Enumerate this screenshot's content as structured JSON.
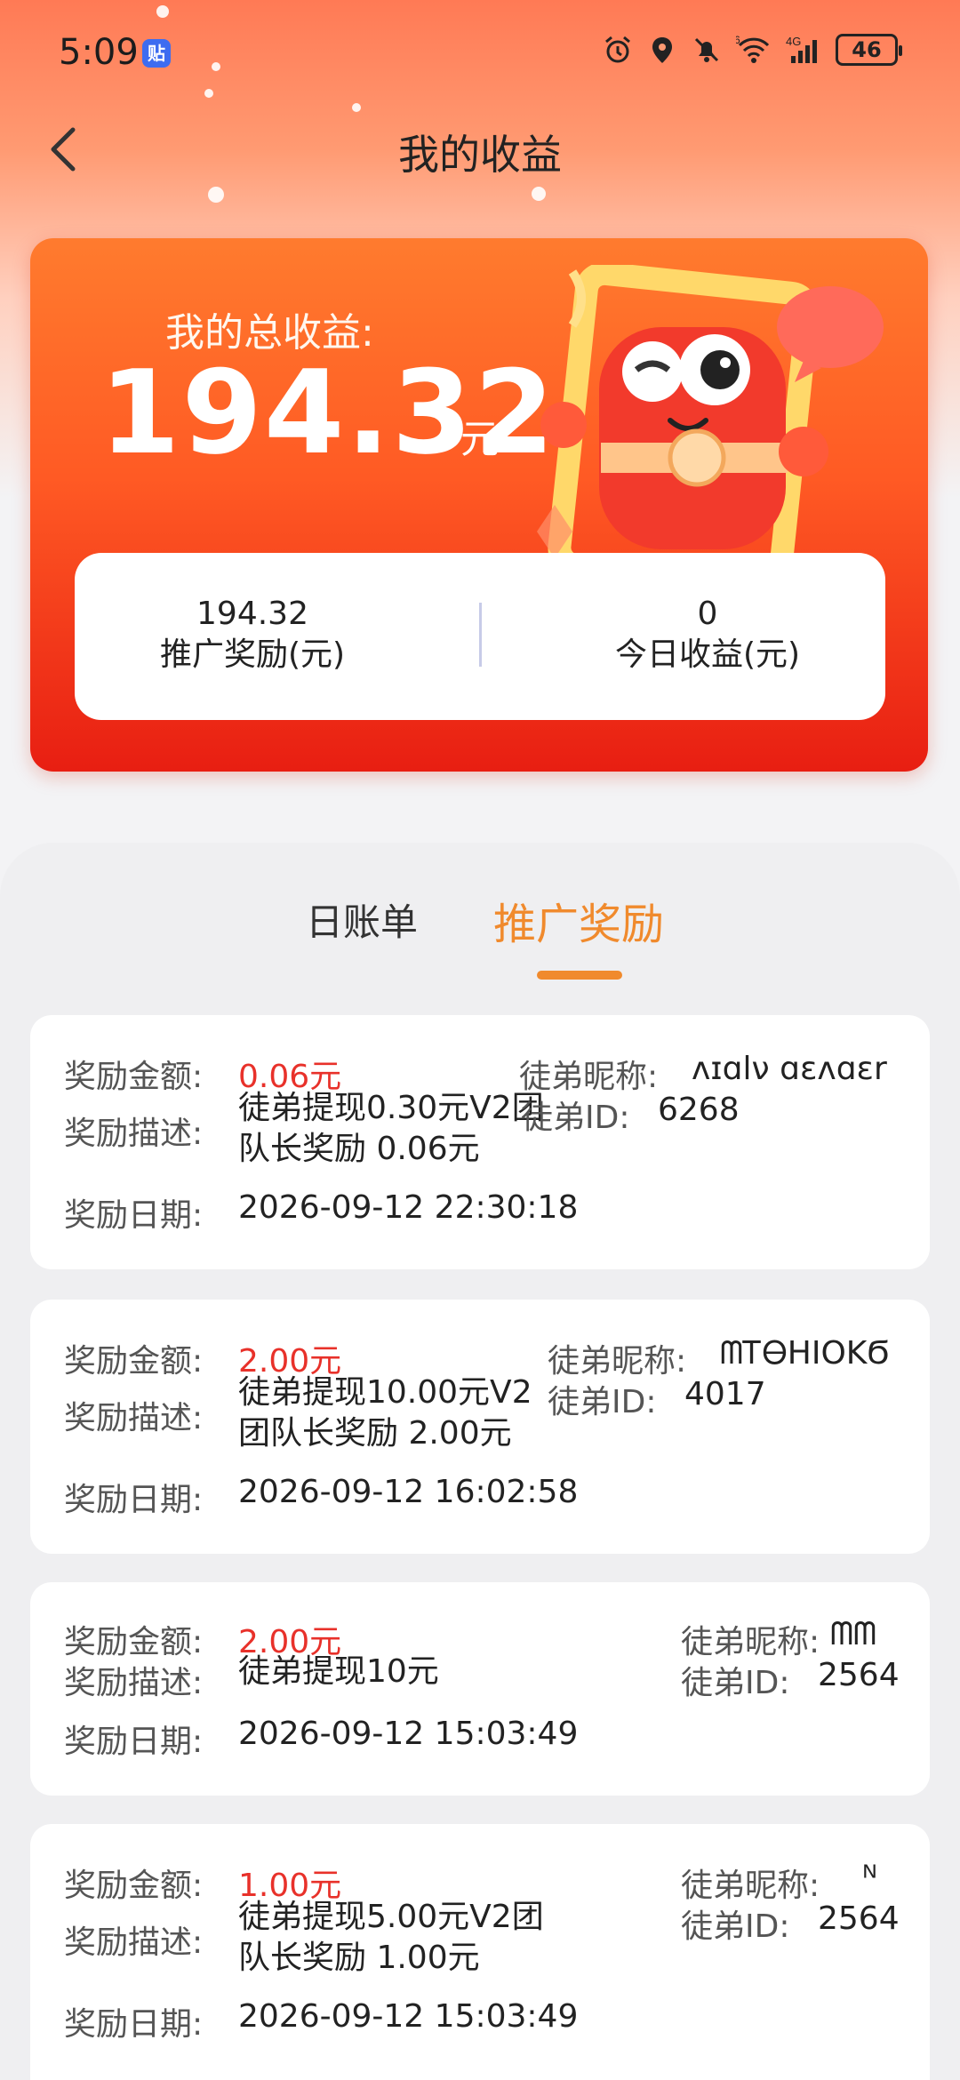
{
  "status_bar": {
    "time": "5:09",
    "app_badge": "贴",
    "network": "4G",
    "wifi_badge": "6",
    "battery": "46"
  },
  "header": {
    "title": "我的收益"
  },
  "summary": {
    "label": "我的总收益:",
    "amount": "194.32",
    "unit": "元",
    "promo_value": "194.32",
    "promo_label": "推广奖励(元)",
    "today_value": "0",
    "today_label": "今日收益(元)"
  },
  "tabs": [
    {
      "label": "日账单",
      "active": false
    },
    {
      "label": "推广奖励",
      "active": true
    }
  ],
  "labels": {
    "amount": "奖励金额:",
    "desc": "奖励描述:",
    "date": "奖励日期:",
    "nickname": "徒弟昵称:",
    "disciple_id": "徒弟ID:"
  },
  "records": [
    {
      "amount": "0.06元",
      "desc_line1": "徒弟提现0.30元V2团",
      "desc_line2": "队长奖励 0.06元",
      "date": "2026-09-12 22:30:18",
      "nickname": "ʌɪɑlν ɑɛʌɑɛr",
      "disciple_id": "6268"
    },
    {
      "amount": "2.00元",
      "desc_line1": "徒弟提现10.00元V2",
      "desc_line2": "团队长奖励 2.00元",
      "date": "2026-09-12 16:02:58",
      "nickname": "ᗰᎢᎾΗΙΟΚϬ",
      "disciple_id": "4017"
    },
    {
      "amount": "2.00元",
      "desc_line1": "徒弟提现10元",
      "desc_line2": "",
      "date": "2026-09-12 15:03:49",
      "nickname": "ᗰᗰ",
      "disciple_id": "2564"
    },
    {
      "amount": "1.00元",
      "desc_line1": "徒弟提现5.00元V2团",
      "desc_line2": "队长奖励 1.00元",
      "date": "2026-09-12 15:03:49",
      "nickname": "ᴺ",
      "disciple_id": "2564"
    }
  ],
  "colors": {
    "accent": "#f08a2d",
    "amount_red": "#e8312a",
    "card_top": "#ff7b2e",
    "card_bottom": "#e81e12"
  }
}
